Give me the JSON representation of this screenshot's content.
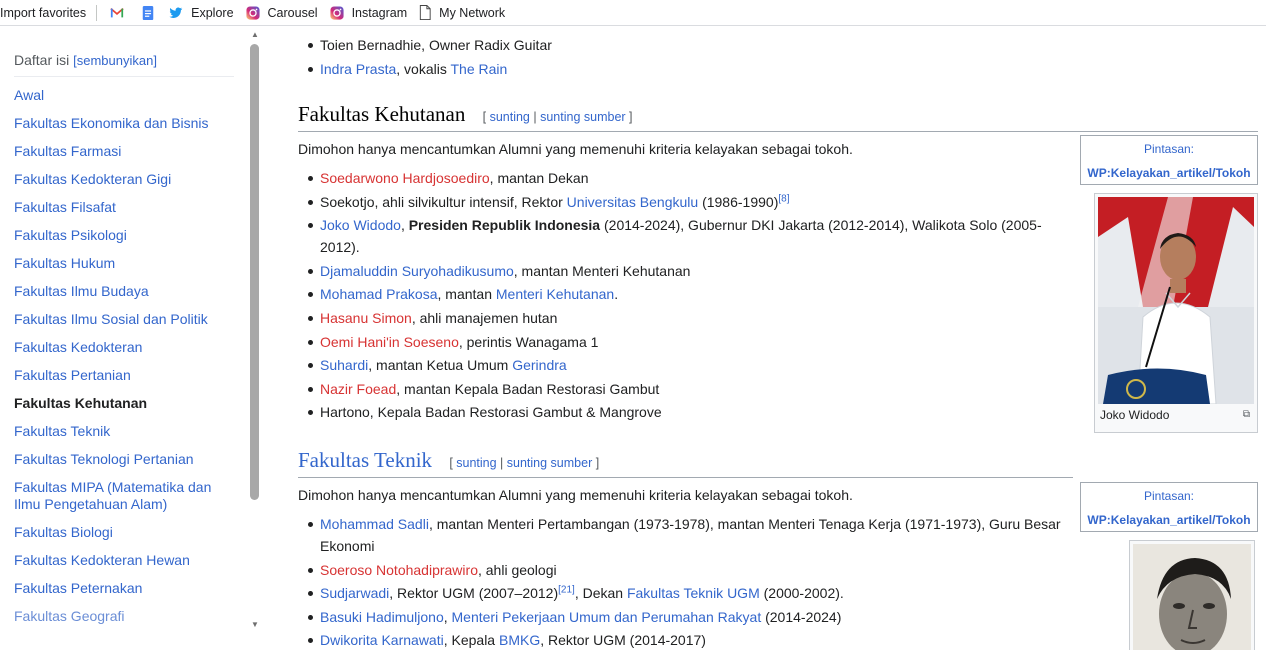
{
  "bookmarks": [
    {
      "label": "Import favorites",
      "icon": "import-icon"
    },
    {
      "label": "",
      "icon": "gmail-icon"
    },
    {
      "label": "",
      "icon": "docs-icon"
    },
    {
      "label": "Explore",
      "icon": "twitter-icon"
    },
    {
      "label": "Carousel",
      "icon": "instagram-icon"
    },
    {
      "label": "Instagram",
      "icon": "instagram-icon"
    },
    {
      "label": "My Network",
      "icon": "page-icon"
    }
  ],
  "toc": {
    "title": "Daftar isi",
    "toggle": "[sembunyikan]",
    "items": [
      "Awal",
      "Fakultas Ekonomika dan Bisnis",
      "Fakultas Farmasi",
      "Fakultas Kedokteran Gigi",
      "Fakultas Filsafat",
      "Fakultas Psikologi",
      "Fakultas Hukum",
      "Fakultas Ilmu Budaya",
      "Fakultas Ilmu Sosial dan Politik",
      "Fakultas Kedokteran",
      "Fakultas Pertanian",
      "Fakultas Kehutanan",
      "Fakultas Teknik",
      "Fakultas Teknologi Pertanian",
      "Fakultas MIPA (Matematika dan Ilmu Pengetahuan Alam)",
      "Fakultas Biologi",
      "Fakultas Kedokteran Hewan",
      "Fakultas Peternakan",
      "Fakultas Geografi"
    ],
    "active_index": 11
  },
  "top_list": {
    "item1": "Toien Bernadhie, Owner Radix Guitar",
    "item2_link": "Indra Prasta",
    "item2_mid": ", vokalis ",
    "item2_link2": "The Rain"
  },
  "kehutanan": {
    "title": "Fakultas Kehutanan",
    "edit_open": "[ ",
    "edit1": "sunting",
    "edit_sep": " | ",
    "edit2": "sunting sumber",
    "edit_close": " ]",
    "intro": "Dimohon hanya mencantumkan Alumni yang memenuhi kriteria kelayakan sebagai tokoh.",
    "hatnote_label": "Pintasan:",
    "hatnote_link": "WP:Kelayakan_artikel/Tokoh",
    "image_caption": "Joko Widodo",
    "items": {
      "i1_link": "Soedarwono Hardjosoedirо",
      "i1_rest": ", mantan Dekan",
      "i2_pre": "Soekotjo, ahli silvikultur intensif, Rektor ",
      "i2_link": "Universitas Bengkulu",
      "i2_rest": " (1986-1990)",
      "i2_ref": "[8]",
      "i3_link": "Joko Widodo",
      "i3_bold": "Presiden Republik Indonesia",
      "i3_rest": " (2014-2024), Gubernur DKI Jakarta (2012-2014), Walikota Solo (2005-2012).",
      "i4_link": "Djamaluddin Suryohadikusumo",
      "i4_rest": ", mantan Menteri Kehutanan",
      "i5_link": "Mohamad Prakosa",
      "i5_mid": ", mantan ",
      "i5_link2": "Menteri Kehutanan",
      "i5_end": ".",
      "i6_link": "Hasanu Simon",
      "i6_rest": ", ahli manajemen hutan",
      "i7_link": "Oemi Hani'in Soeseno",
      "i7_rest": ", perintis Wanagama 1",
      "i8_link": "Suhardi",
      "i8_mid": ", mantan Ketua Umum ",
      "i8_link2": "Gerindra",
      "i9_link": "Nazir Foead",
      "i9_rest": ", mantan Kepala Badan Restorasi Gambut",
      "i10": "Hartono, Kepala Badan Restorasi Gambut & Mangrove"
    }
  },
  "teknik": {
    "title": "Fakultas Teknik",
    "edit_open": "[ ",
    "edit1": "sunting",
    "edit_sep": " | ",
    "edit2": "sunting sumber",
    "edit_close": " ]",
    "intro": "Dimohon hanya mencantumkan Alumni yang memenuhi kriteria kelayakan sebagai tokoh.",
    "hatnote_label": "Pintasan:",
    "hatnote_link": "WP:Kelayakan_artikel/Tokoh",
    "items": {
      "i1_link": "Mohammad Sadli",
      "i1_rest": ", mantan Menteri Pertambangan (1973-1978), mantan Menteri Tenaga Kerja (1971-1973), Guru Besar Ekonomi",
      "i2_link": "Soeroso Notohadiprawiro",
      "i2_rest": ", ahli geologi",
      "i3_link": "Sudjarwadi",
      "i3_mid": ", Rektor UGM (2007–2012)",
      "i3_ref": "[21]",
      "i3_mid2": ", Dekan ",
      "i3_link2": "Fakultas Teknik UGM",
      "i3_end": " (2000-2002).",
      "i4_link": "Basuki Hadimuljono",
      "i4_mid": ", ",
      "i4_link2": "Menteri Pekerjaan Umum dan Perumahan Rakyat",
      "i4_end": " (2014-2024)",
      "i5_link": "Dwikorita Karnawati",
      "i5_mid": ", Kepala ",
      "i5_link2": "BMKG",
      "i5_end": ", Rektor UGM (2014-2017)"
    }
  }
}
